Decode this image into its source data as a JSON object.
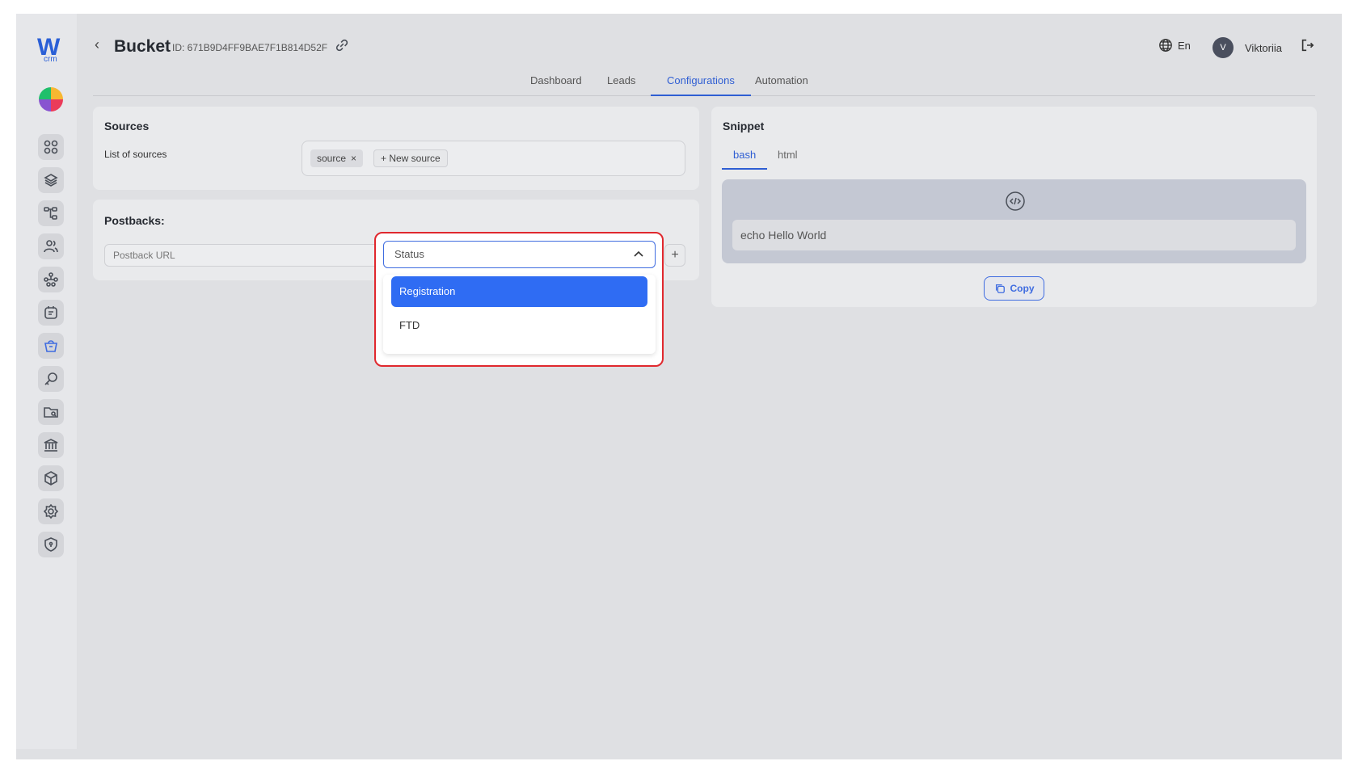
{
  "header": {
    "back": "‹",
    "title": "Bucket",
    "id_label": "ID: 671B9D4FF9BAE7F1B814D52F",
    "language": "En",
    "avatar_initial": "V",
    "username": "Viktoriia"
  },
  "tabs": [
    {
      "label": "Dashboard",
      "active": false
    },
    {
      "label": "Leads",
      "active": false
    },
    {
      "label": "Configurations",
      "active": true
    },
    {
      "label": "Automation",
      "active": false
    }
  ],
  "sources": {
    "title": "Sources",
    "list_label": "List of sources",
    "chips": [
      {
        "label": "source",
        "remove": "×"
      }
    ],
    "new_source_label": "+ New source"
  },
  "postbacks": {
    "title": "Postbacks:",
    "url_placeholder": "Postback URL",
    "add": "+"
  },
  "status_dropdown": {
    "placeholder": "Status",
    "options": [
      {
        "label": "Registration",
        "selected": true
      },
      {
        "label": "FTD",
        "selected": false
      }
    ]
  },
  "snippet": {
    "title": "Snippet",
    "tabs": [
      {
        "label": "bash",
        "active": true
      },
      {
        "label": "html",
        "active": false
      }
    ],
    "code": "echo Hello World",
    "copy_label": "Copy"
  },
  "colors": {
    "accent": "#2f5ed3",
    "selected_option": "#2f6cf3",
    "highlight_border": "#e0282e"
  }
}
